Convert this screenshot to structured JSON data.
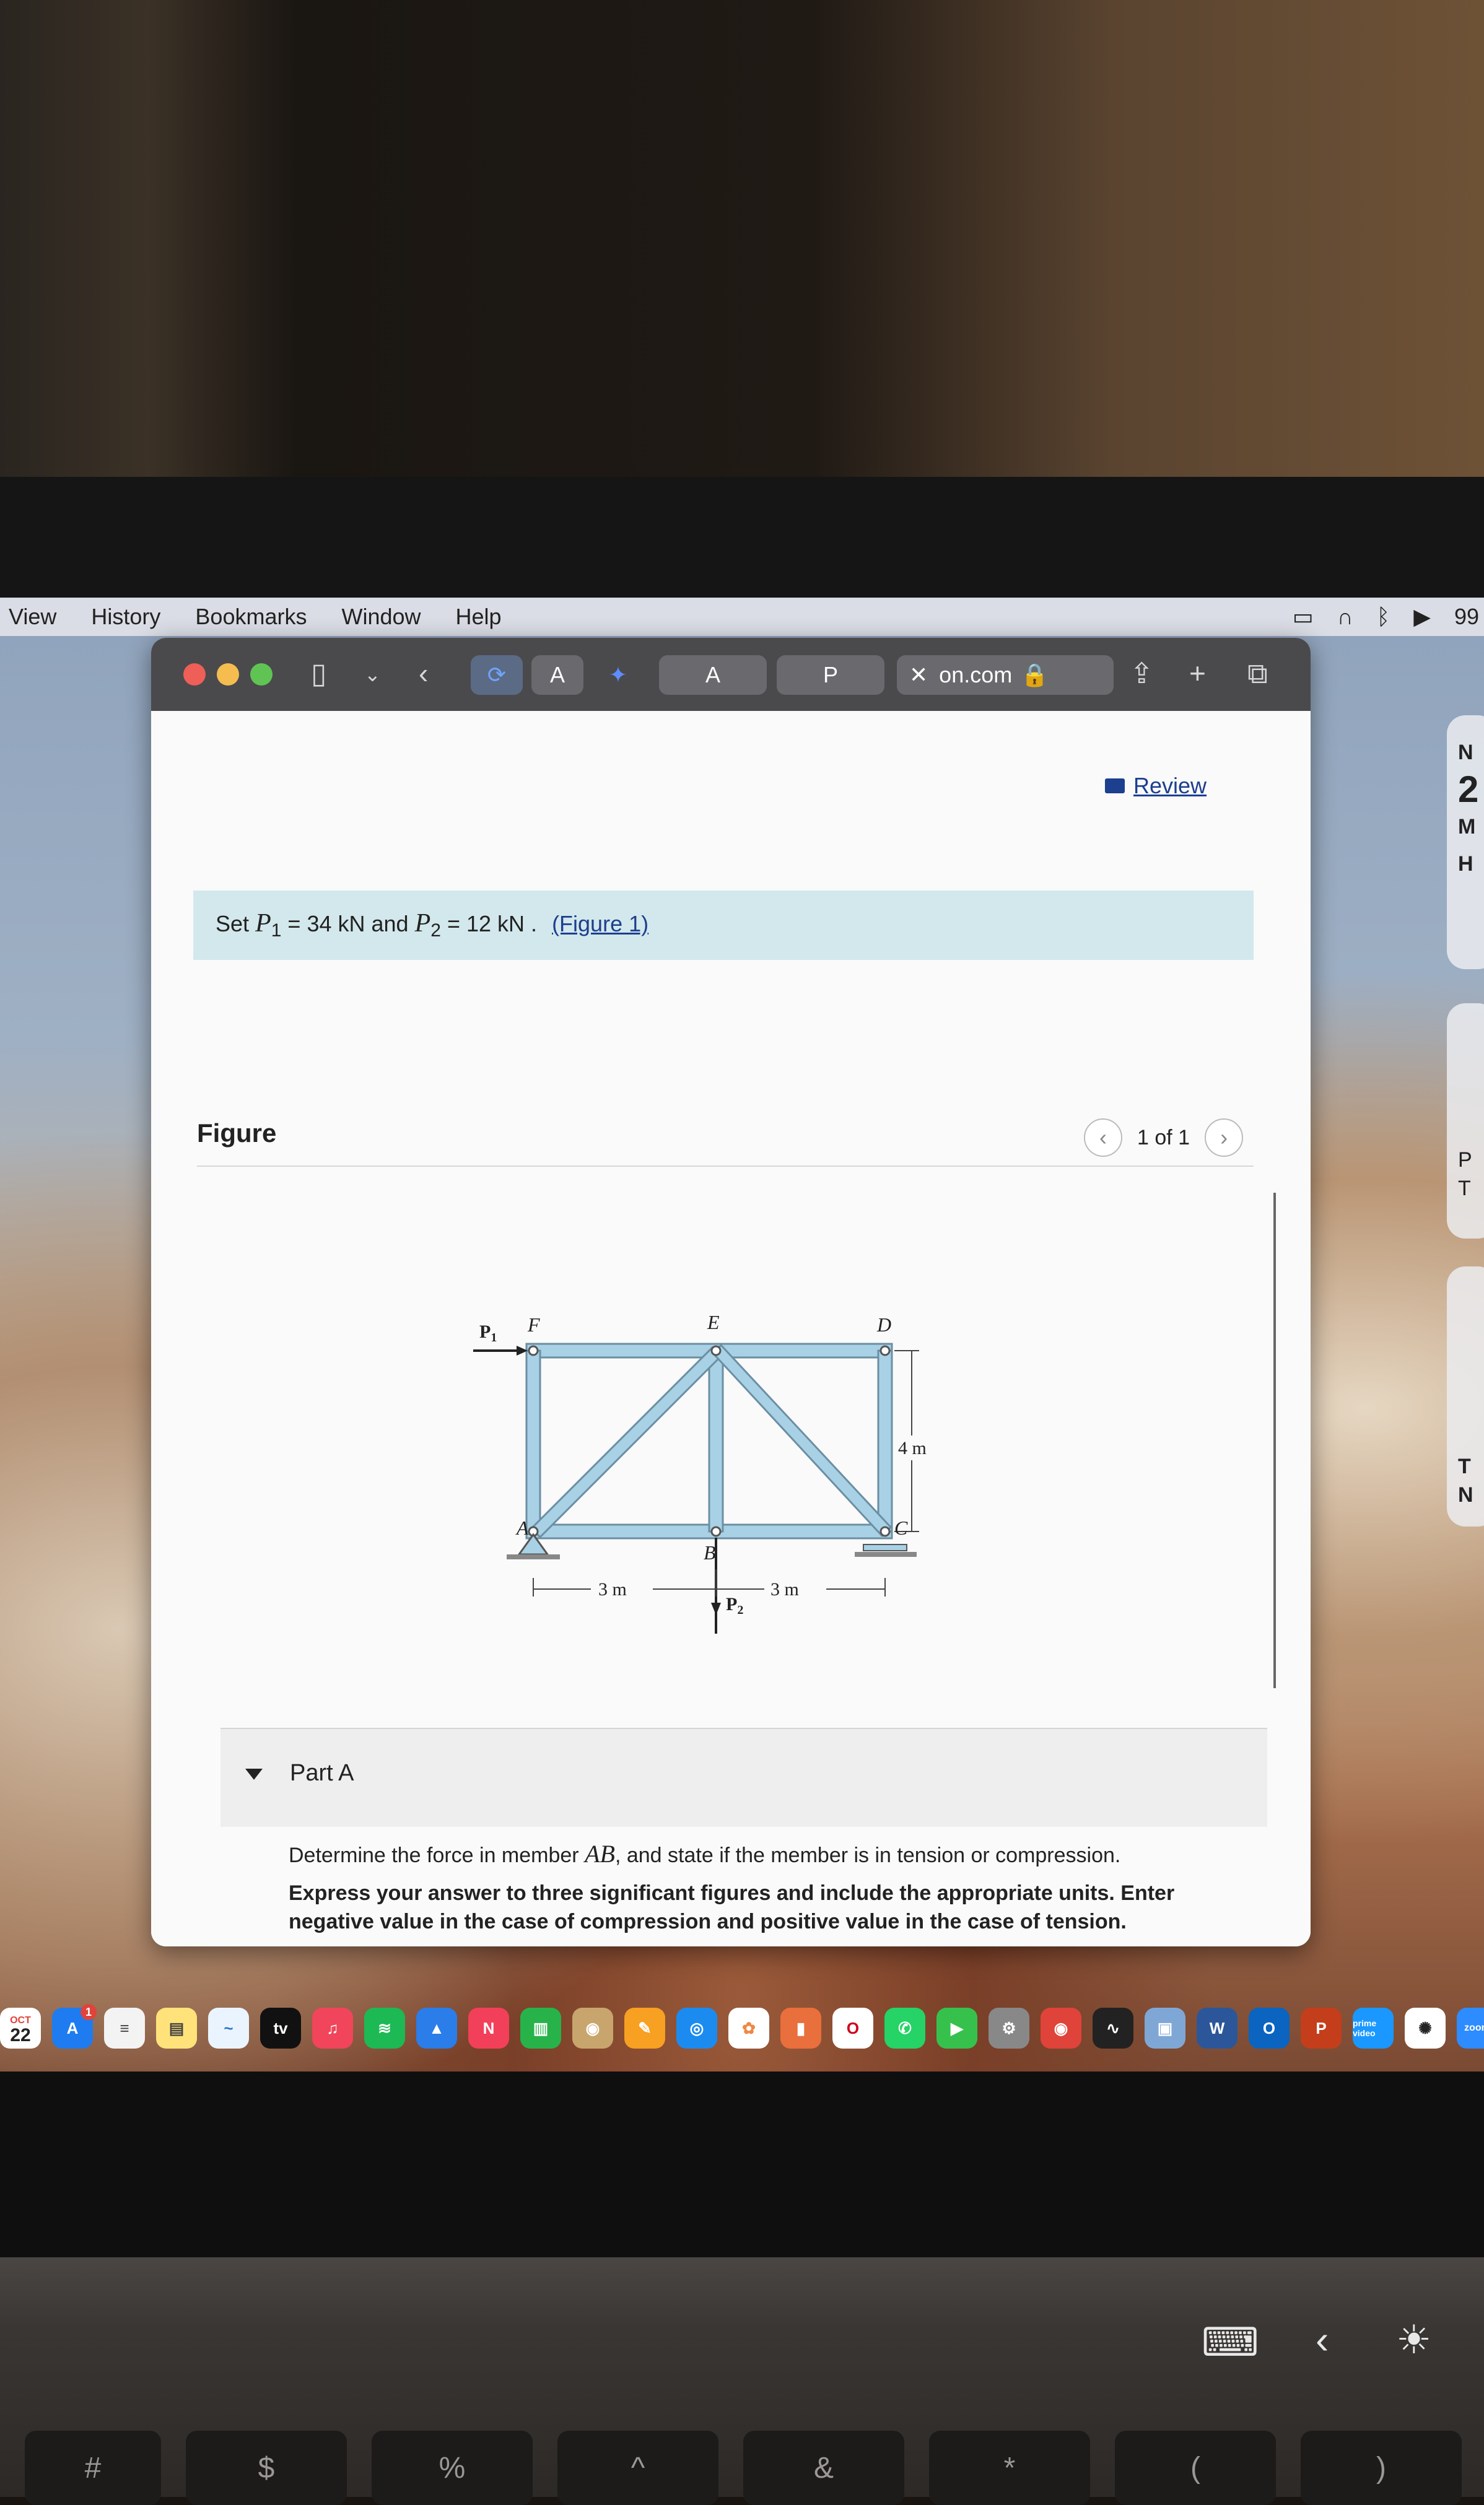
{
  "menubar": {
    "items": [
      "View",
      "History",
      "Bookmarks",
      "Window",
      "Help"
    ],
    "battery": "99"
  },
  "browser": {
    "address": "on.com",
    "tab_p": "P"
  },
  "page": {
    "review_label": "Review",
    "problem": {
      "text_set": "Set",
      "p1_var": "P",
      "p1_sub": "1",
      "p1_value": "= 34  kN",
      "and": "and",
      "p2_var": "P",
      "p2_sub": "2",
      "p2_value": "= 12  kN .",
      "figure_link": "(Figure 1)"
    },
    "figure": {
      "title": "Figure",
      "pagination": "1 of 1"
    },
    "part_a": {
      "label": "Part A",
      "q_prefix": "Determine the force in member",
      "q_member": "AB",
      "q_suffix": ", and state if the member is in tension or compression.",
      "instructions": "Express your answer to three significant figures and include the appropriate units. Enter negative value in the case of compression and positive value in the case of tension."
    }
  },
  "truss": {
    "nodes": [
      "A",
      "B",
      "C",
      "D",
      "E",
      "F"
    ],
    "load_p1": "P",
    "load_p1_sub": "1",
    "load_p2": "P",
    "load_p2_sub": "2",
    "dim_left": "3 m",
    "dim_right": "3 m",
    "dim_height": "4 m"
  },
  "dock": {
    "date_month": "OCT",
    "date_day": "22",
    "tv_label": "tv",
    "prime_label": "prime video",
    "zoom_label": "zoom",
    "appstore_badge": "1"
  },
  "widgets": {
    "w1_line1": "N",
    "w1_line2": "2",
    "w1_line3": "M",
    "w1_line4": "H",
    "w2_line1": "P",
    "w2_line2": "T",
    "w3_line1": "T",
    "w3_line2": "N"
  },
  "keyboard": {
    "keys": [
      "#",
      "$",
      "%",
      "^",
      "&",
      "*",
      "(",
      ")"
    ]
  },
  "colors": {
    "truss_member": "#a9d1e6",
    "truss_outline": "#6b8fa3",
    "problem_bg": "#d3e8ec",
    "link": "#1c3f8f",
    "toolbar": "#4a4a4d"
  }
}
